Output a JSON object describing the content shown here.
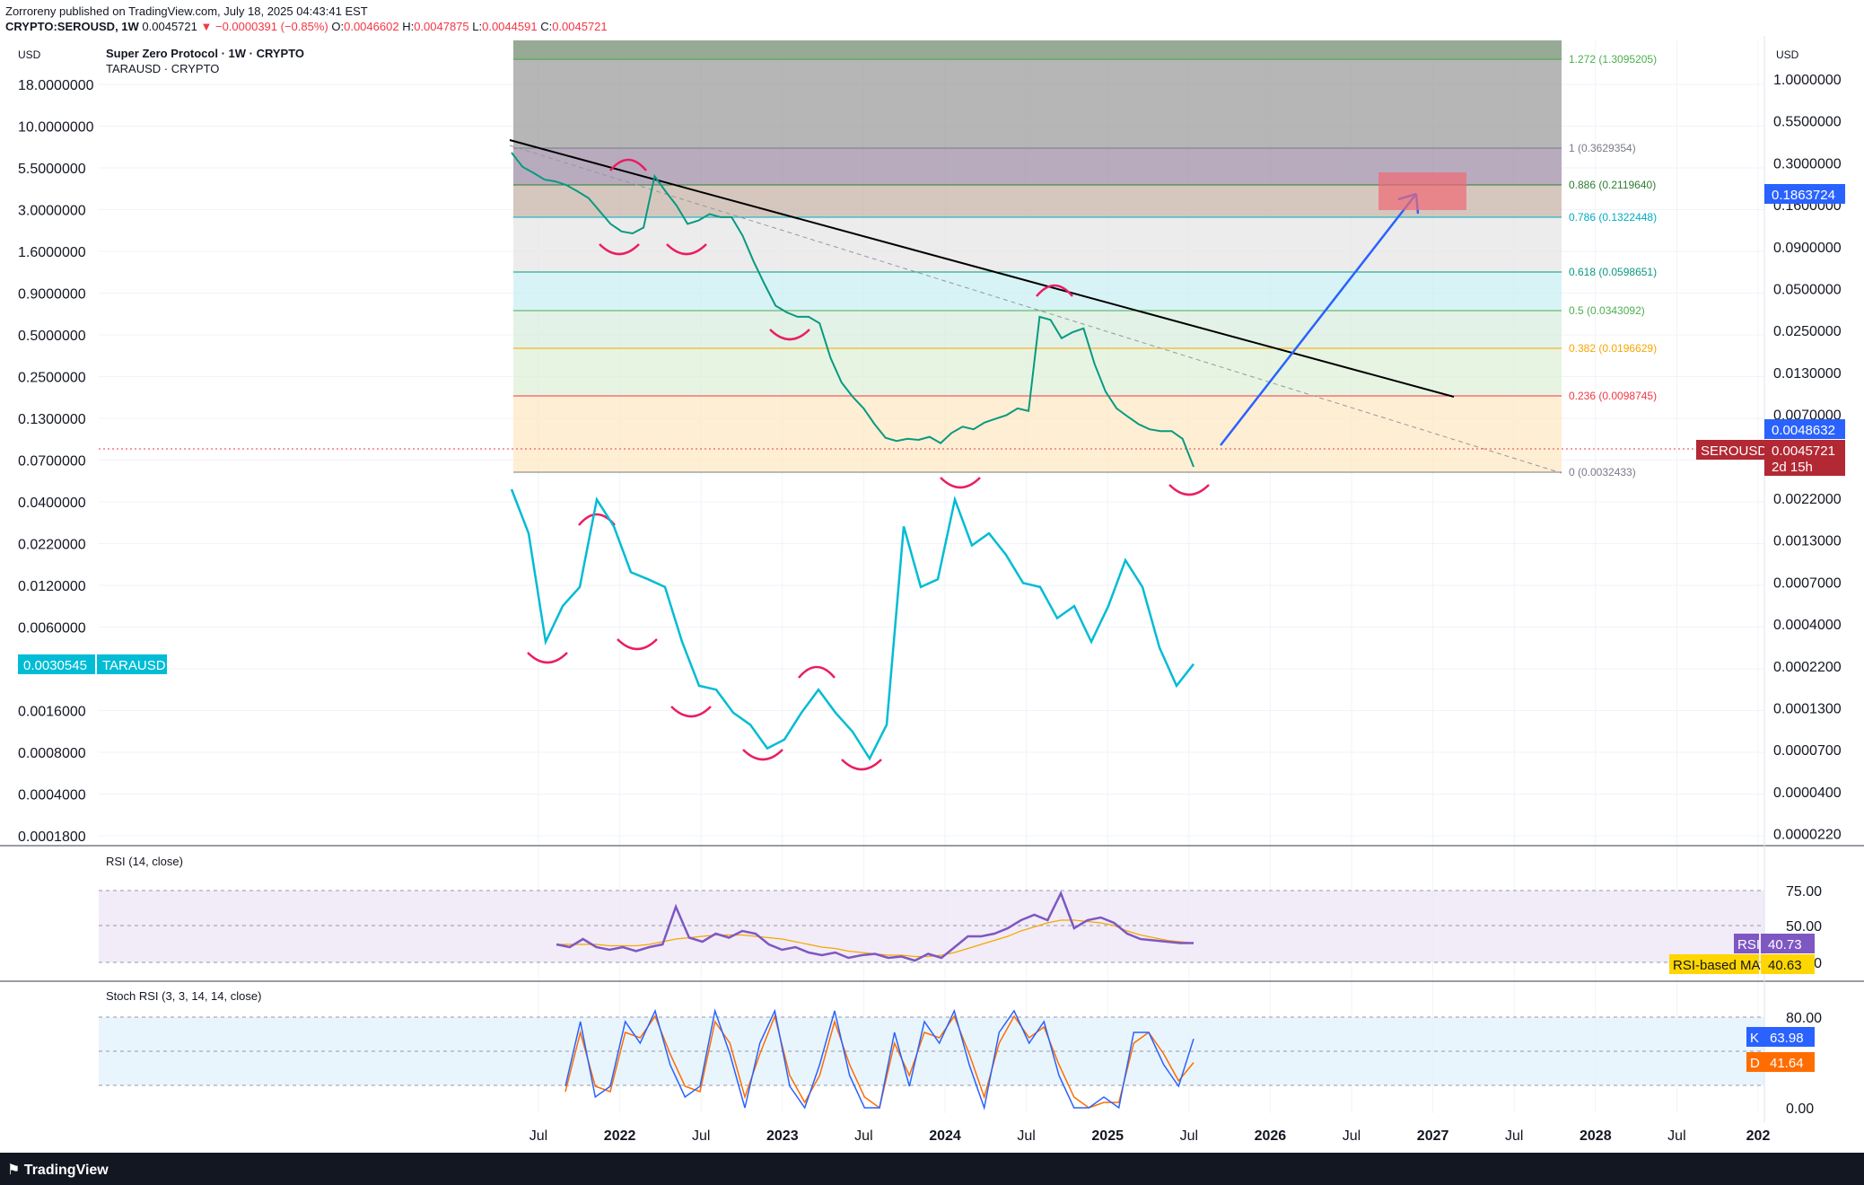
{
  "header": {
    "published": "Zorroreny published on TradingView.com, July 18, 2025 04:43:41 EST",
    "symbol_line": "CRYPTO:SEROUSD, 1W",
    "price": "0.0045721",
    "change": "▼ −0.0000391 (−0.85%)",
    "o_label": "O:",
    "o": "0.0046602",
    "h_label": "H:",
    "h": "0.0047875",
    "l_label": "L:",
    "l": "0.0044591",
    "c_label": "C:",
    "c": "0.0045721"
  },
  "footer": {
    "brand": "TradingView"
  },
  "chart_data": [
    {
      "type": "line",
      "title": "Super Zero Protocol · 1W · CRYPTO",
      "subtitle": "TARAUSD · CRYPTO",
      "left_unit": "USD",
      "right_unit": "USD",
      "scale": "log",
      "x_ticks": [
        "Jul",
        "2022",
        "Jul",
        "2023",
        "Jul",
        "2024",
        "Jul",
        "2025",
        "Jul",
        "2026",
        "Jul",
        "2027",
        "Jul",
        "2028",
        "Jul",
        "202"
      ],
      "x_tick_bold": [
        false,
        true,
        false,
        true,
        false,
        true,
        false,
        true,
        false,
        true,
        false,
        true,
        false,
        true,
        false,
        true
      ],
      "left_ticks": [
        "18.0000000",
        "10.0000000",
        "5.5000000",
        "3.0000000",
        "1.6000000",
        "0.9000000",
        "0.5000000",
        "0.2500000",
        "0.1300000",
        "0.0700000",
        "0.0400000",
        "0.0220000",
        "0.0120000",
        "0.0060000",
        "0.0030000",
        "0.0016000",
        "0.0008000",
        "0.0004000",
        "0.0001800"
      ],
      "right_ticks": [
        "1.0000000",
        "0.5500000",
        "0.3000000",
        "0.1600000",
        "0.0900000",
        "0.0500000",
        "0.0250000",
        "0.0130000",
        "0.0070000",
        "0.0040000",
        "0.0022000",
        "0.0013000",
        "0.0007000",
        "0.0004000",
        "0.0002200",
        "0.0001300",
        "0.0000700",
        "0.0000400",
        "0.0000220"
      ],
      "fib_levels": [
        {
          "label": "1.272 (1.3095205)",
          "color": "#4caf50"
        },
        {
          "label": "1 (0.3629354)",
          "color": "#787b86"
        },
        {
          "label": "0.886 (0.2119640)",
          "color": "#2e7d32"
        },
        {
          "label": "0.786 (0.1322448)",
          "color": "#00acc1"
        },
        {
          "label": "0.618 (0.0598651)",
          "color": "#089981"
        },
        {
          "label": "0.5 (0.0343092)",
          "color": "#4caf50"
        },
        {
          "label": "0.382 (0.0196629)",
          "color": "#f7a600"
        },
        {
          "label": "0.236 (0.0098745)",
          "color": "#f23645"
        },
        {
          "label": "0 (0.0032433)",
          "color": "#787b86"
        }
      ],
      "series": [
        {
          "name": "SEROUSD",
          "color": "#089981",
          "values": [
            5.5,
            4.4,
            4.0,
            3.6,
            3.5,
            3.3,
            3.0,
            2.7,
            2.2,
            1.8,
            1.6,
            1.55,
            1.7,
            3.8,
            3.0,
            2.4,
            1.8,
            1.9,
            2.1,
            2.0,
            2.0,
            1.5,
            1.0,
            0.7,
            0.5,
            0.45,
            0.42,
            0.42,
            0.38,
            0.22,
            0.15,
            0.12,
            0.1,
            0.078,
            0.063,
            0.06,
            0.062,
            0.061,
            0.064,
            0.058,
            0.068,
            0.075,
            0.072,
            0.08,
            0.085,
            0.09,
            0.1,
            0.096,
            0.42,
            0.4,
            0.3,
            0.33,
            0.35,
            0.2,
            0.13,
            0.1,
            0.088,
            0.078,
            0.072,
            0.07,
            0.07,
            0.062,
            0.0046
          ]
        },
        {
          "name": "TARAUSD",
          "color": "#00bcd4",
          "values": [
            0.035,
            0.018,
            0.0035,
            0.006,
            0.008,
            0.03,
            0.02,
            0.01,
            0.009,
            0.008,
            0.0035,
            0.0018,
            0.0017,
            0.0012,
            0.001,
            0.0007,
            0.0008,
            0.0012,
            0.0017,
            0.0012,
            0.0009,
            0.0006,
            0.001,
            0.02,
            0.008,
            0.009,
            0.03,
            0.015,
            0.018,
            0.013,
            0.0085,
            0.008,
            0.005,
            0.006,
            0.0035,
            0.006,
            0.012,
            0.008,
            0.0032,
            0.0018,
            0.0025
          ]
        }
      ],
      "last_price_label": "0.0048632",
      "seroudsd_tag": "SEROUSD",
      "sero_price": "0.0045721",
      "countdown": "2d 15h",
      "target_price": "0.1863724",
      "tara_price": "0.0030545",
      "tara_tag": "TARAUSD"
    },
    {
      "type": "line",
      "title": "RSI (14, close)",
      "y_ticks": [
        "75.00",
        "50.00",
        "25.00"
      ],
      "series": [
        {
          "name": "RSI",
          "color": "#7e57c2",
          "values": [
            40,
            38,
            44,
            38,
            36,
            38,
            35,
            38,
            40,
            68,
            45,
            42,
            48,
            45,
            50,
            48,
            40,
            36,
            38,
            34,
            32,
            34,
            30,
            32,
            33,
            30,
            31,
            28,
            33,
            30,
            38,
            46,
            46,
            48,
            52,
            58,
            62,
            58,
            78,
            52,
            58,
            60,
            56,
            48,
            44,
            43,
            42,
            41,
            41
          ]
        },
        {
          "name": "RSI-based MA",
          "color": "#f7a600",
          "values": [
            40,
            40,
            40,
            40,
            39,
            39,
            39,
            40,
            42,
            44,
            45,
            46,
            47,
            47,
            47,
            46,
            45,
            44,
            42,
            40,
            38,
            37,
            35,
            34,
            33,
            32,
            32,
            31,
            31,
            32,
            34,
            37,
            40,
            43,
            46,
            50,
            53,
            56,
            58,
            58,
            57,
            56,
            54,
            50,
            47,
            45,
            43,
            42,
            41
          ]
        }
      ],
      "rsi_value": "40.73",
      "ma_value": "40.63"
    },
    {
      "type": "line",
      "title": "Stoch RSI (3, 3, 14, 14, close)",
      "y_ticks": [
        "80.00",
        "0.00"
      ],
      "series": [
        {
          "name": "K",
          "color": "#2962ff",
          "values": [
            20,
            80,
            10,
            20,
            80,
            60,
            90,
            40,
            10,
            20,
            90,
            50,
            0,
            60,
            90,
            20,
            0,
            40,
            90,
            30,
            0,
            0,
            70,
            20,
            80,
            60,
            90,
            40,
            0,
            70,
            90,
            60,
            80,
            30,
            0,
            0,
            10,
            0,
            70,
            70,
            40,
            20,
            64
          ]
        },
        {
          "name": "D",
          "color": "#ff6d00",
          "values": [
            15,
            70,
            20,
            15,
            70,
            65,
            85,
            50,
            20,
            15,
            80,
            60,
            10,
            50,
            85,
            30,
            5,
            30,
            80,
            40,
            10,
            0,
            60,
            30,
            70,
            65,
            85,
            50,
            10,
            60,
            85,
            65,
            75,
            40,
            10,
            0,
            5,
            5,
            60,
            70,
            50,
            25,
            42
          ]
        }
      ],
      "k_label": "K",
      "k_value": "63.98",
      "d_label": "D",
      "d_value": "41.64"
    }
  ]
}
